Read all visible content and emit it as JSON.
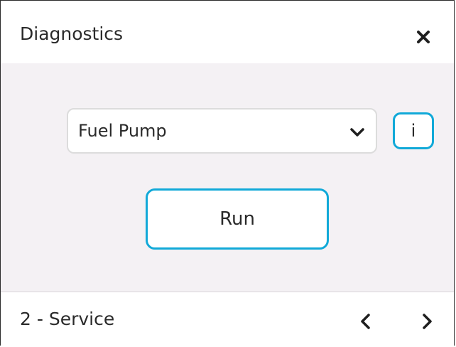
{
  "header": {
    "title": "Diagnostics",
    "close_icon": "close-icon"
  },
  "diagnostic": {
    "selected_component": "Fuel Pump",
    "dropdown_icon": "chevron-down-icon",
    "info_label": "i",
    "run_label": "Run"
  },
  "footer": {
    "page_label": "2 - Service",
    "prev_icon": "chevron-left-icon",
    "next_icon": "chevron-right-icon"
  },
  "colors": {
    "accent": "#11a9d8",
    "panel_background": "#f4f1f4",
    "text": "#2a2a2a"
  }
}
